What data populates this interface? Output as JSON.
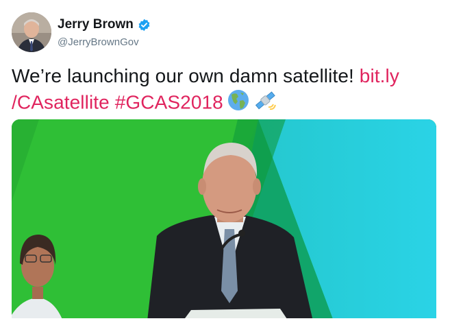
{
  "tweet": {
    "author": {
      "display_name": "Jerry Brown",
      "handle": "@JerryBrownGov",
      "verified": true
    },
    "text_plain": "We’re launching our own damn satellite! ",
    "link_part1": "bit.ly",
    "link_part2": "/CAsatellite",
    "hashtag": "#GCAS2018",
    "emojis": [
      "globe-americas-icon",
      "satellite-icon"
    ]
  },
  "colors": {
    "link": "#e0245e",
    "verified_badge": "#1da1f2",
    "handle_text": "#657786",
    "media_green": "#2fbf3a",
    "media_cyan": "#22c3d8"
  },
  "media": {
    "type": "video",
    "progress": 1.0
  }
}
